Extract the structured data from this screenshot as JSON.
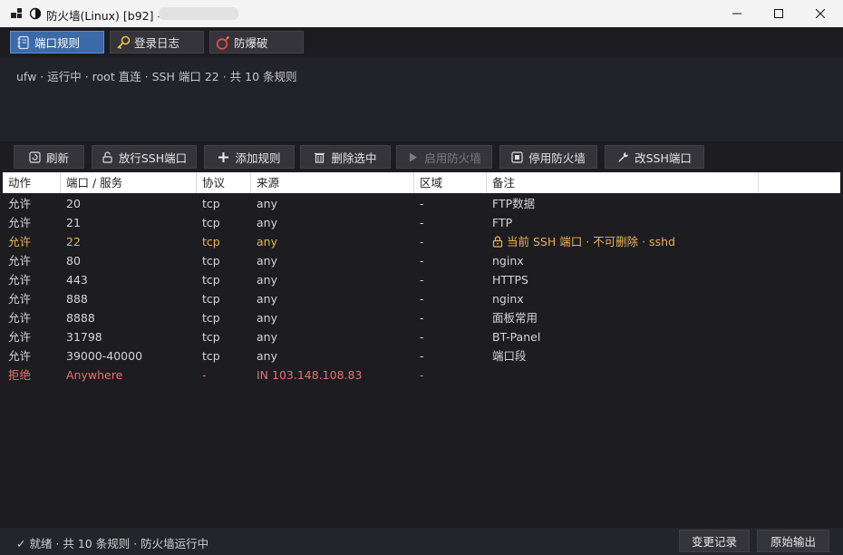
{
  "window": {
    "title": "防火墙(Linux) [b92] — 10"
  },
  "tabs": [
    {
      "label": "端口规则",
      "icon": "notebook-icon",
      "active": true
    },
    {
      "label": "登录日志",
      "icon": "key-icon",
      "active": false
    },
    {
      "label": "防爆破",
      "icon": "bomb-icon",
      "active": false
    }
  ],
  "info": {
    "text": "ufw · 运行中 · root 直连 · SSH 端口 22 · 共 10 条规则"
  },
  "toolbar": {
    "refresh": "刷新",
    "allow_ssh": "放行SSH端口",
    "add_rule": "添加规则",
    "delete_selected": "删除选中",
    "enable_firewall": "启用防火墙",
    "disable_firewall": "停用防火墙",
    "change_ssh_port": "改SSH端口"
  },
  "table": {
    "columns": [
      "动作",
      "端口 / 服务",
      "协议",
      "来源",
      "区域",
      "备注"
    ],
    "rows": [
      {
        "action": "允许",
        "port": "20",
        "proto": "tcp",
        "source": "any",
        "zone": "-",
        "note": "FTP数据"
      },
      {
        "action": "允许",
        "port": "21",
        "proto": "tcp",
        "source": "any",
        "zone": "-",
        "note": "FTP"
      },
      {
        "action": "允许",
        "port": "22",
        "proto": "tcp",
        "source": "any",
        "zone": "-",
        "note": "当前 SSH 端口 · 不可删除 · sshd"
      },
      {
        "action": "允许",
        "port": "80",
        "proto": "tcp",
        "source": "any",
        "zone": "-",
        "note": "nginx"
      },
      {
        "action": "允许",
        "port": "443",
        "proto": "tcp",
        "source": "any",
        "zone": "-",
        "note": "HTTPS"
      },
      {
        "action": "允许",
        "port": "888",
        "proto": "tcp",
        "source": "any",
        "zone": "-",
        "note": "nginx"
      },
      {
        "action": "允许",
        "port": "8888",
        "proto": "tcp",
        "source": "any",
        "zone": "-",
        "note": "面板常用"
      },
      {
        "action": "允许",
        "port": "31798",
        "proto": "tcp",
        "source": "any",
        "zone": "-",
        "note": "BT-Panel"
      },
      {
        "action": "允许",
        "port": "39000-40000",
        "proto": "tcp",
        "source": "any",
        "zone": "-",
        "note": "端口段"
      },
      {
        "action": "拒绝",
        "port": "Anywhere",
        "proto": "-",
        "source": "IN 103.148.108.83",
        "zone": "-",
        "note": ""
      }
    ]
  },
  "status": {
    "text": "✓ 就绪 · 共 10 条规则 · 防火墙运行中",
    "change_log": "变更记录",
    "raw_output": "原始输出"
  },
  "colors": {
    "accent": "#3c6aa8",
    "ssh_row": "#e8b35a",
    "deny_row": "#e5736a",
    "background": "#1c1c21"
  }
}
